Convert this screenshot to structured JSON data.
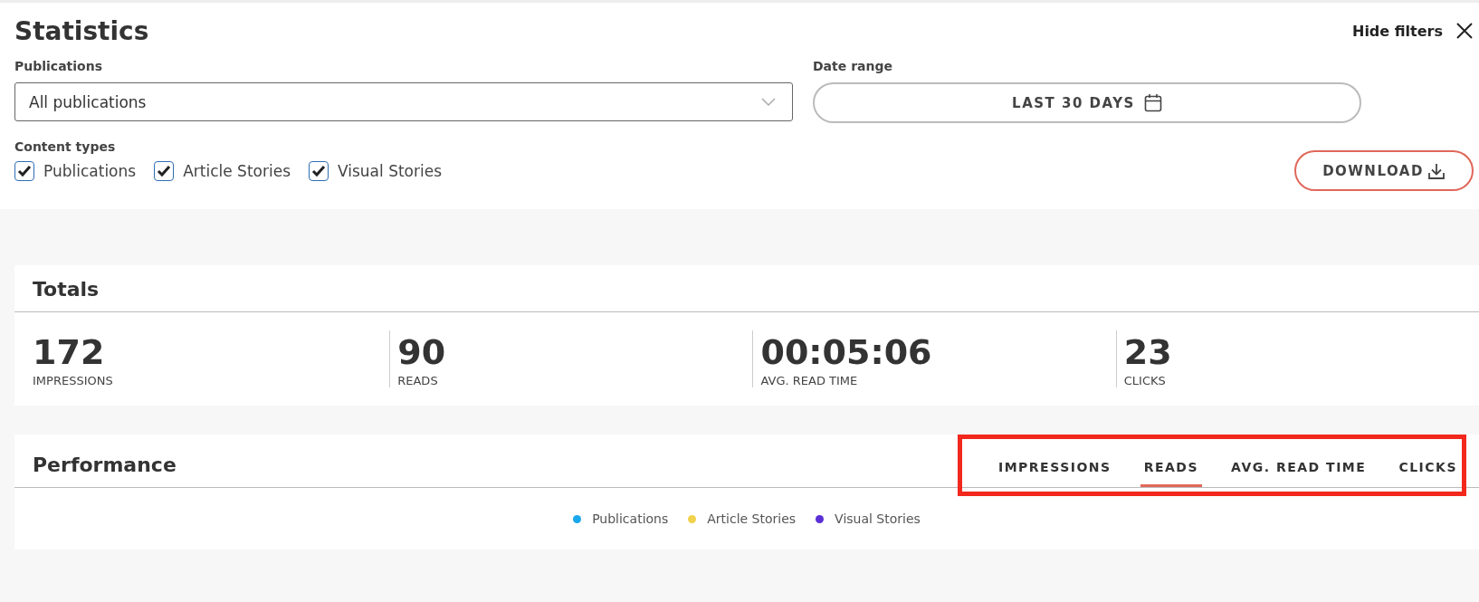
{
  "header": {
    "title": "Statistics",
    "hide_filters": "Hide filters"
  },
  "filters": {
    "publications": {
      "label": "Publications",
      "value": "All publications"
    },
    "date_range": {
      "label": "Date range",
      "value": "LAST 30 DAYS"
    },
    "content_types": {
      "label": "Content types",
      "options": [
        {
          "label": "Publications",
          "checked": true
        },
        {
          "label": "Article Stories",
          "checked": true
        },
        {
          "label": "Visual Stories",
          "checked": true
        }
      ]
    },
    "download": "DOWNLOAD"
  },
  "totals": {
    "title": "Totals",
    "stats": [
      {
        "value": "172",
        "label": "IMPRESSIONS"
      },
      {
        "value": "90",
        "label": "READS"
      },
      {
        "value": "00:05:06",
        "label": "AVG. READ TIME"
      },
      {
        "value": "23",
        "label": "CLICKS"
      }
    ]
  },
  "performance": {
    "title": "Performance",
    "tabs": [
      {
        "label": "IMPRESSIONS",
        "selected": false
      },
      {
        "label": "READS",
        "selected": true
      },
      {
        "label": "AVG. READ TIME",
        "selected": false
      },
      {
        "label": "CLICKS",
        "selected": false
      }
    ],
    "legend": [
      {
        "label": "Publications",
        "color": "#1aa7ec"
      },
      {
        "label": "Article Stories",
        "color": "#f2d24b"
      },
      {
        "label": "Visual Stories",
        "color": "#5b2fd6"
      }
    ]
  }
}
